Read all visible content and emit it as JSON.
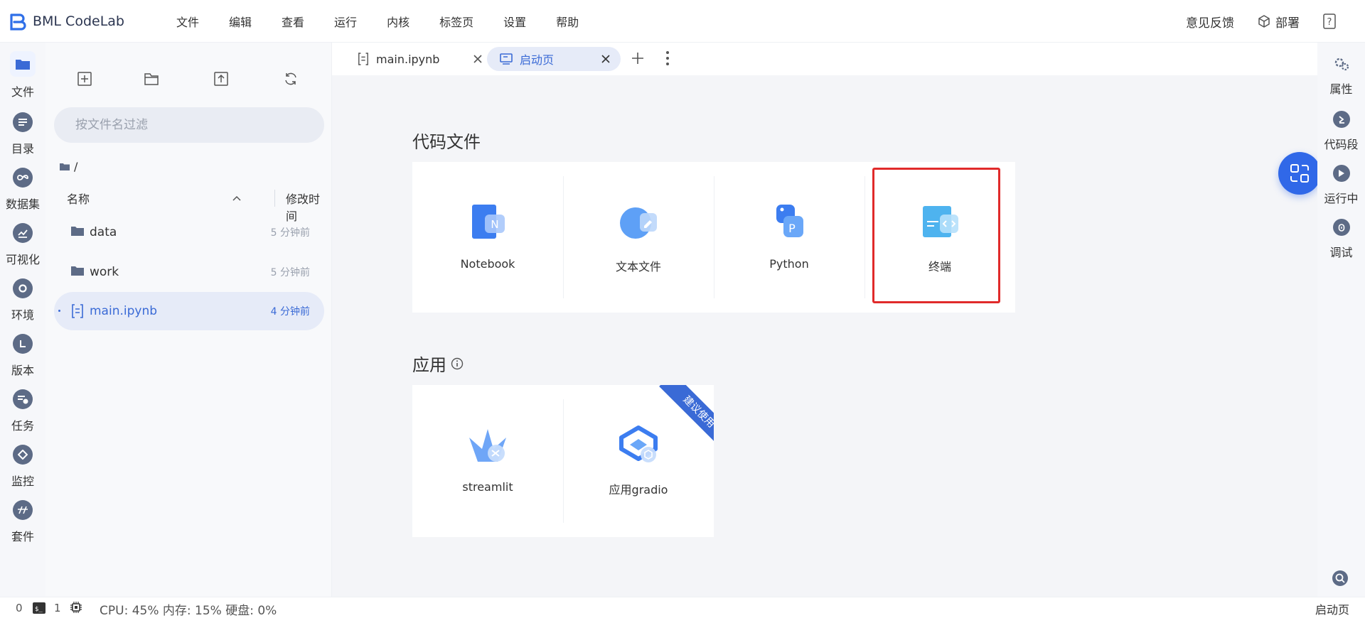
{
  "app": {
    "title": "BML CodeLab"
  },
  "menu": [
    "文件",
    "编辑",
    "查看",
    "运行",
    "内核",
    "标签页",
    "设置",
    "帮助"
  ],
  "topright": {
    "feedback": "意见反馈",
    "deploy": "部署",
    "help_icon": "?"
  },
  "leftnav": [
    "文件",
    "目录",
    "数据集",
    "可视化",
    "环境",
    "版本",
    "任务",
    "监控",
    "套件"
  ],
  "filepanel": {
    "filter_placeholder": "按文件名过滤",
    "path": "/",
    "col_name": "名称",
    "col_time": "修改时间",
    "files": [
      {
        "name": "data",
        "time": "5 分钟前",
        "type": "folder"
      },
      {
        "name": "work",
        "time": "5 分钟前",
        "type": "folder"
      },
      {
        "name": "main.ipynb",
        "time": "4 分钟前",
        "type": "notebook"
      }
    ]
  },
  "tabs": [
    {
      "label": "main.ipynb"
    },
    {
      "label": "启动页"
    }
  ],
  "launcher": {
    "code_title": "代码文件",
    "code_items": [
      "Notebook",
      "文本文件",
      "Python",
      "终端"
    ],
    "app_title": "应用",
    "app_items": [
      "streamlit",
      "应用gradio"
    ],
    "ribbon": "建议使用"
  },
  "rightnav": [
    "属性",
    "代码段",
    "运行中",
    "调试"
  ],
  "status": {
    "left_count": "0",
    "terminal_count": "1",
    "usage": "CPU:  45% 内存:  15% 硬盘:  0%",
    "right": "启动页"
  },
  "colors": {
    "accent": "#3a6ad6",
    "fab": "#3068e8",
    "highlight": "#e02a2a"
  }
}
